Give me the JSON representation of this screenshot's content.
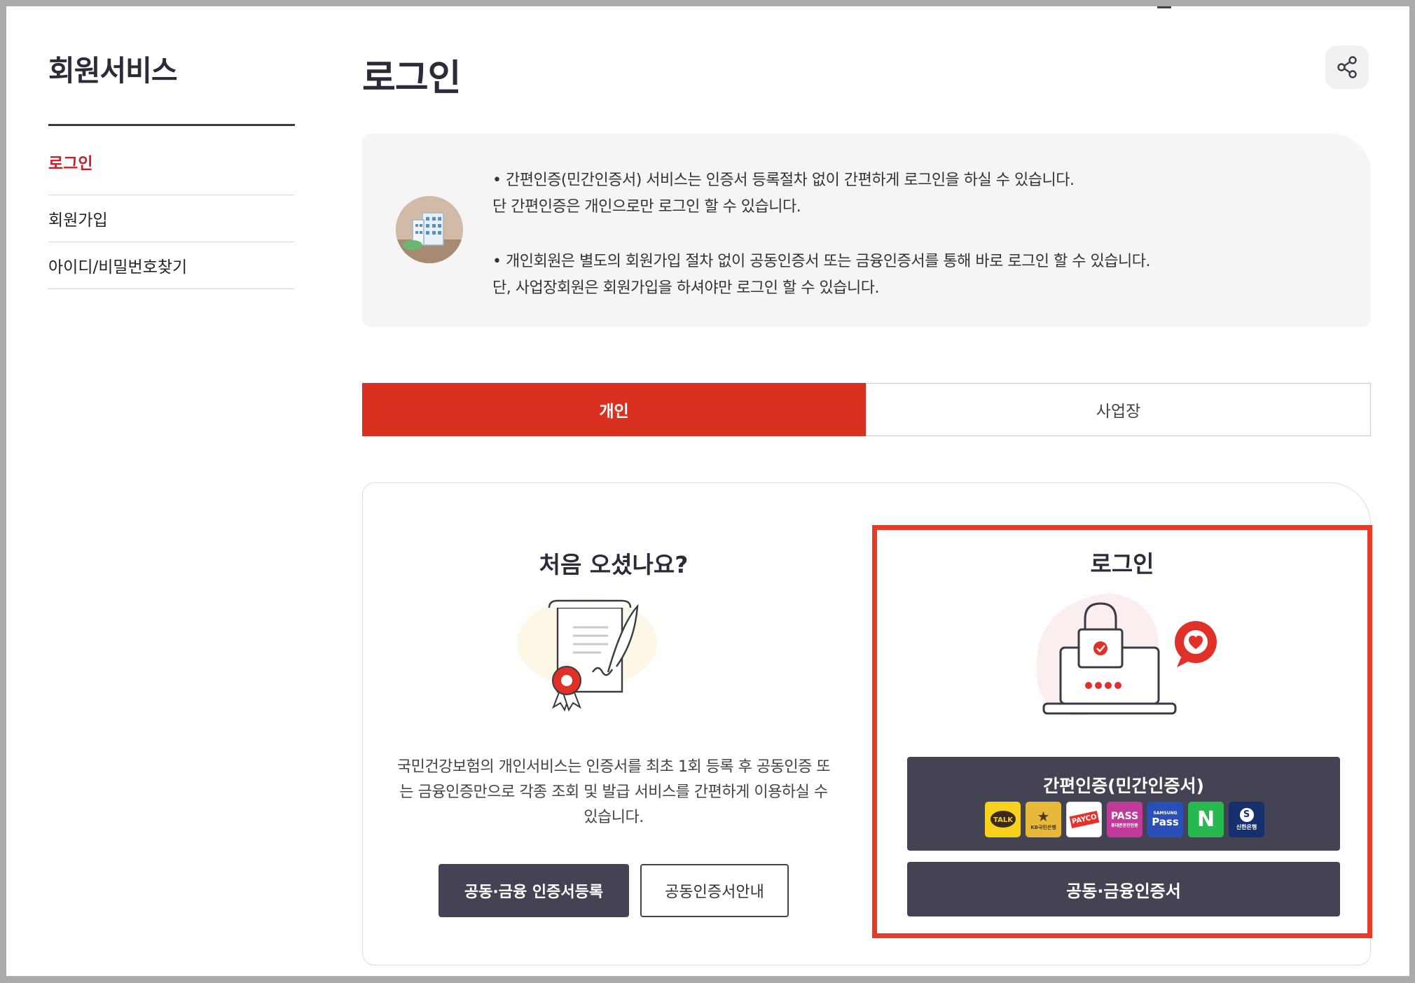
{
  "sidebar": {
    "title": "회원서비스",
    "items": [
      {
        "label": "로그인"
      },
      {
        "label": "회원가입"
      },
      {
        "label": "아이디/비밀번호찾기"
      }
    ]
  },
  "header": {
    "title": "로그인",
    "share_icon": "share-icon"
  },
  "info": {
    "lines": [
      "•  간편인증(민간인증서) 서비스는 인증서 등록절차 없이 간편하게 로그인을 하실 수 있습니다.",
      "단 간편인증은 개인으로만 로그인 할 수 있습니다.",
      "•  개인회원은 별도의 회원가입 절차 없이 공동인증서 또는 금융인증서를 통해 바로 로그인 할 수 있습니다.",
      "단, 사업장회원은 회원가입을 하셔야만 로그인 할 수 있습니다."
    ]
  },
  "tabs": [
    {
      "label": "개인"
    },
    {
      "label": "사업장"
    }
  ],
  "newcomer": {
    "title": "처음 오셨나요?",
    "description": "국민건강보험의 개인서비스는 인증서를 최초 1회 등록 후 공동인증 또는 금융인증만으로 각종 조회 및 발급 서비스를 간편하게 이용하실 수 있습니다.",
    "register_button": "공동·금융 인증서등록",
    "guide_button": "공동인증서안내"
  },
  "login": {
    "title": "로그인",
    "simple_auth_button": "간편인증(민간인증서)",
    "cert_button": "공동·금융인증서",
    "providers": [
      {
        "name": "kakao",
        "text": "TALK",
        "bg": "#f7d21d",
        "fg": "#3a2a1a"
      },
      {
        "name": "kb",
        "text": "KB국민은행",
        "bg": "#e8b83a",
        "fg": "#4a3a1a"
      },
      {
        "name": "payco",
        "text": "PAYCO",
        "bg": "#ffffff",
        "fg": "#e8302a"
      },
      {
        "name": "pass-sk",
        "text": "PASS",
        "bg": "#c03a9a",
        "fg": "#ffffff"
      },
      {
        "name": "samsung-pass",
        "text": "Pass",
        "bg": "#2b4fb8",
        "fg": "#ffffff"
      },
      {
        "name": "naver",
        "text": "N",
        "bg": "#28b850",
        "fg": "#ffffff"
      },
      {
        "name": "shinhan",
        "text": "신한은행",
        "bg": "#16306e",
        "fg": "#ffffff"
      }
    ]
  },
  "colors": {
    "accent_red": "#d93020",
    "dark_button": "#434353",
    "highlight_border": "#e83a28",
    "active_menu": "#c8202a"
  }
}
